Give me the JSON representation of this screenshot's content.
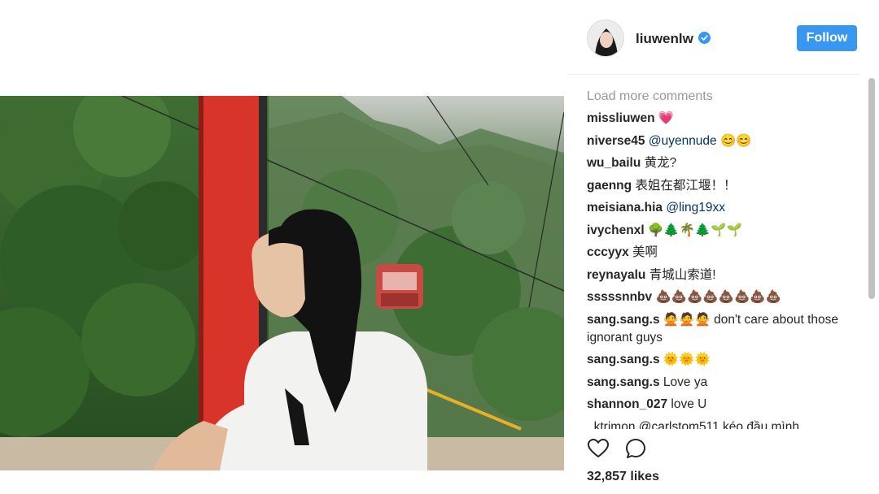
{
  "post": {
    "username": "liuwenlw",
    "follow_label": "Follow",
    "likes": "32,857 likes"
  },
  "comments_section": {
    "load_more": "Load more comments",
    "items": [
      {
        "user": "missliuwen",
        "text": "💗"
      },
      {
        "user": "niverse45",
        "text": "@uyennude 😊😊"
      },
      {
        "user": "wu_bailu",
        "text": "黄龙?"
      },
      {
        "user": "gaenng",
        "text": "表姐在都江堰！！"
      },
      {
        "user": "meisiana.hia",
        "text": "@ling19xx"
      },
      {
        "user": "ivychenxl",
        "text": "🌳🌲🌴🌲🌱🌱"
      },
      {
        "user": "cccyyx",
        "text": "美啊"
      },
      {
        "user": "reynayalu",
        "text": "青城山索道!"
      },
      {
        "user": "sssssnnbv",
        "text": "💩💩💩💩💩💩💩💩"
      },
      {
        "user": "sang.sang.s",
        "text": "🙅🙅🙅 don't care about those ignorant guys"
      },
      {
        "user": "sang.sang.s",
        "text": "🌞🌞🌞"
      },
      {
        "user": "sang.sang.s",
        "text": "Love ya"
      },
      {
        "user": "shannon_027",
        "text": "love U"
      }
    ],
    "partial_row": "_ktrimon @carlstom511 kéo đầu mình"
  },
  "icons": {
    "verified": "verified-badge-icon",
    "like": "heart-icon",
    "comment": "comment-bubble-icon"
  },
  "colors": {
    "follow_button": "#3897f0",
    "mention": "#003569",
    "verified": "#3897f0",
    "gondola_red": "#d8342a"
  }
}
